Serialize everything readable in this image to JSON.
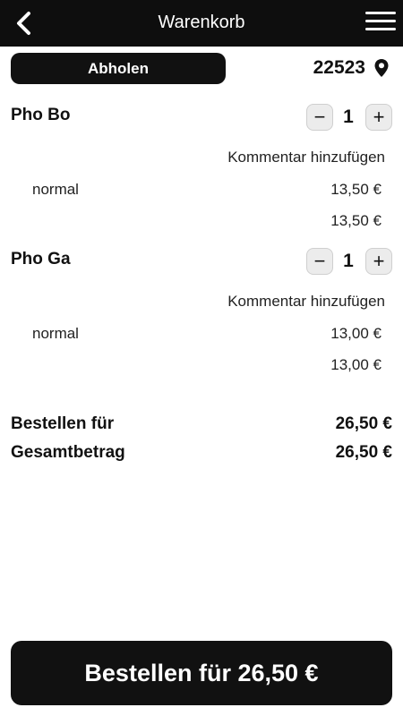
{
  "header": {
    "title": "Warenkorb",
    "back_icon": "chevron-left-icon",
    "menu_icon": "hamburger-menu-icon",
    "background": "#0e0e0e"
  },
  "delivery": {
    "mode_label": "Abholen",
    "postcode": "22523",
    "location_icon": "map-pin-icon"
  },
  "items": [
    {
      "name": "Pho Bo",
      "quantity": "1",
      "decrement_label": "−",
      "increment_label": "+",
      "comment_label": "Kommentar hinzufügen",
      "variant": "normal",
      "variant_price": "13,50 €",
      "total_price": "13,50 €"
    },
    {
      "name": "Pho Ga",
      "quantity": "1",
      "decrement_label": "−",
      "increment_label": "+",
      "comment_label": "Kommentar hinzufügen",
      "variant": "normal",
      "variant_price": "13,00 €",
      "total_price": "13,00 €"
    }
  ],
  "summary": {
    "order_for_label": "Bestellen für",
    "order_for_value": "26,50 €",
    "total_label": "Gesamtbetrag",
    "total_value": "26,50 €"
  },
  "order_button": {
    "label": "Bestellen für 26,50 €"
  }
}
